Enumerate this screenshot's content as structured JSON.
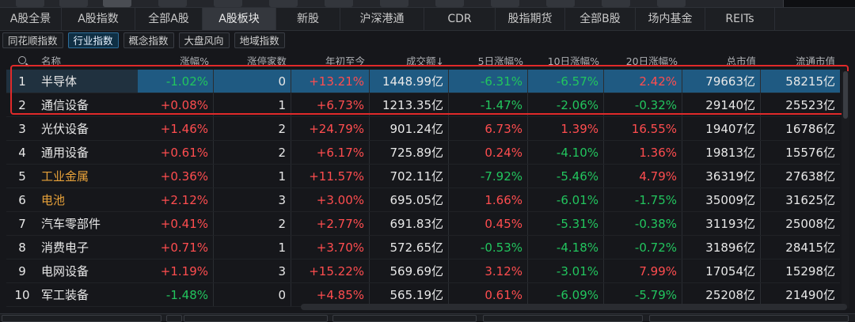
{
  "colors": {
    "up": "#ff4d4f",
    "down": "#22c55e",
    "flat": "#e8e8e8",
    "highlight_name": "#e8a23a",
    "selection": "#1f5a82",
    "annotation_box": "#e02a2a"
  },
  "main_tabs": [
    {
      "label": "A股全景",
      "width": 78
    },
    {
      "label": "A股指数",
      "width": 93
    },
    {
      "label": "全部A股",
      "width": 85
    },
    {
      "label": "A股板块",
      "width": 93,
      "active": true
    },
    {
      "label": "新股",
      "width": 81
    },
    {
      "label": "沪深港通",
      "width": 106
    },
    {
      "label": "CDR",
      "width": 90
    },
    {
      "label": "股指期货",
      "width": 88
    },
    {
      "label": "全部B股",
      "width": 89
    },
    {
      "label": "场内基金",
      "width": 88
    },
    {
      "label": "REITs",
      "width": 88
    }
  ],
  "sub_tabs": [
    {
      "label": "同花顺指数"
    },
    {
      "label": "行业指数",
      "active": true
    },
    {
      "label": "概念指数"
    },
    {
      "label": "大盘风向"
    },
    {
      "label": "地域指数"
    }
  ],
  "table": {
    "headers": [
      "名称",
      "涨幅%",
      "涨停家数",
      "年初至今",
      "成交额↓",
      "5日涨幅%",
      "10日涨幅%",
      "20日涨幅%",
      "总市值",
      "流通市值"
    ],
    "rows": [
      {
        "idx": "1",
        "name": "半导体",
        "chg": "-1.02%",
        "lim": "0",
        "ytd": "+13.21%",
        "vol": "1448.99亿",
        "d5": "-6.31%",
        "d10": "-6.57%",
        "d20": "2.42%",
        "mkt": "79663亿",
        "flt": "58215亿",
        "selected": true
      },
      {
        "idx": "2",
        "name": "通信设备",
        "chg": "+0.08%",
        "lim": "1",
        "ytd": "+6.73%",
        "vol": "1213.35亿",
        "d5": "-1.47%",
        "d10": "-2.06%",
        "d20": "-0.32%",
        "mkt": "29140亿",
        "flt": "25523亿"
      },
      {
        "idx": "3",
        "name": "光伏设备",
        "chg": "+1.46%",
        "lim": "2",
        "ytd": "+24.79%",
        "vol": "901.24亿",
        "d5": "6.73%",
        "d10": "1.39%",
        "d20": "16.55%",
        "mkt": "19407亿",
        "flt": "16786亿"
      },
      {
        "idx": "4",
        "name": "通用设备",
        "chg": "+0.61%",
        "lim": "2",
        "ytd": "+6.17%",
        "vol": "725.89亿",
        "d5": "0.24%",
        "d10": "-4.10%",
        "d20": "1.36%",
        "mkt": "19813亿",
        "flt": "15576亿"
      },
      {
        "idx": "5",
        "name": "工业金属",
        "chg": "+0.36%",
        "lim": "1",
        "ytd": "+11.57%",
        "vol": "702.11亿",
        "d5": "-7.92%",
        "d10": "-5.46%",
        "d20": "4.79%",
        "mkt": "36319亿",
        "flt": "27638亿",
        "name_color": "gold"
      },
      {
        "idx": "6",
        "name": "电池",
        "chg": "+2.12%",
        "lim": "3",
        "ytd": "+3.00%",
        "vol": "695.05亿",
        "d5": "1.66%",
        "d10": "-6.01%",
        "d20": "-1.75%",
        "mkt": "35009亿",
        "flt": "31625亿",
        "name_color": "gold"
      },
      {
        "idx": "7",
        "name": "汽车零部件",
        "chg": "+0.41%",
        "lim": "2",
        "ytd": "+2.77%",
        "vol": "691.83亿",
        "d5": "0.45%",
        "d10": "-5.31%",
        "d20": "-0.38%",
        "mkt": "31193亿",
        "flt": "25008亿"
      },
      {
        "idx": "8",
        "name": "消费电子",
        "chg": "+0.71%",
        "lim": "1",
        "ytd": "+3.70%",
        "vol": "572.65亿",
        "d5": "-0.53%",
        "d10": "-4.18%",
        "d20": "-0.72%",
        "mkt": "31896亿",
        "flt": "28415亿"
      },
      {
        "idx": "9",
        "name": "电网设备",
        "chg": "+1.19%",
        "lim": "3",
        "ytd": "+15.22%",
        "vol": "569.69亿",
        "d5": "3.12%",
        "d10": "-3.01%",
        "d20": "7.99%",
        "mkt": "17054亿",
        "flt": "15298亿"
      },
      {
        "idx": "10",
        "name": "军工装备",
        "chg": "-1.48%",
        "lim": "0",
        "ytd": "+4.85%",
        "vol": "565.19亿",
        "d5": "0.61%",
        "d10": "-6.09%",
        "d20": "-5.79%",
        "mkt": "25208亿",
        "flt": "21490亿"
      }
    ]
  }
}
